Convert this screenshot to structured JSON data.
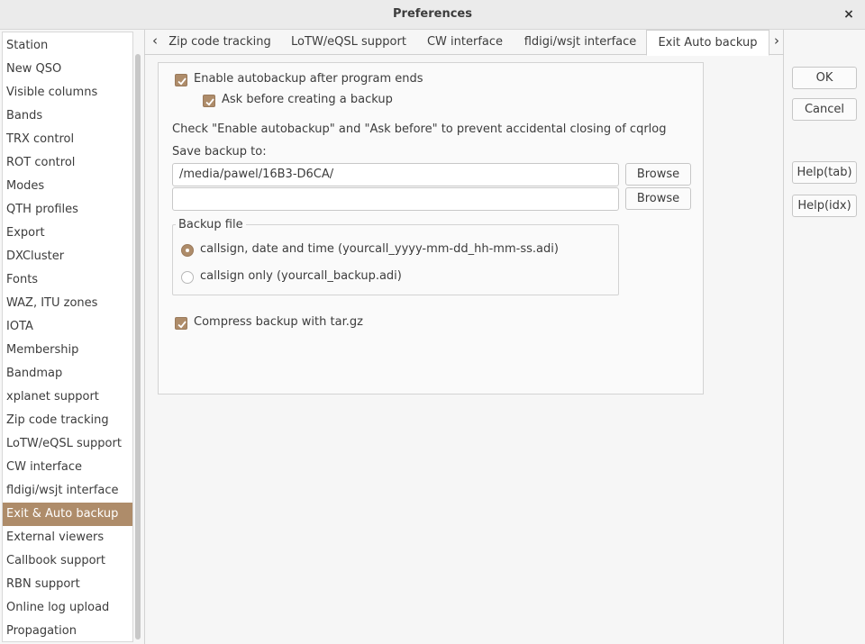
{
  "window": {
    "title": "Preferences",
    "close_glyph": "×"
  },
  "sidebar": {
    "selected_index": 21,
    "items": [
      "Station",
      "New QSO",
      "Visible columns",
      "Bands",
      "TRX control",
      "ROT control",
      "Modes",
      "QTH profiles",
      "Export",
      "DXCluster",
      "Fonts",
      "WAZ, ITU zones",
      "IOTA",
      "Membership",
      "Bandmap",
      "xplanet support",
      "Zip code tracking",
      "LoTW/eQSL support",
      "CW interface",
      "fldigi/wsjt interface",
      "Exit & Auto backup",
      "External viewers",
      "Callbook support",
      "RBN support",
      "Online log upload",
      "Propagation"
    ]
  },
  "tabs": {
    "left_arrow": "‹",
    "right_arrow": "›",
    "items": [
      "Zip code tracking",
      "LoTW/eQSL support",
      "CW interface",
      "fldigi/wsjt interface",
      "Exit  Auto backup"
    ],
    "active_index": 4
  },
  "backup": {
    "enable_autobackup": {
      "label": "Enable autobackup after program ends",
      "checked": true
    },
    "ask_before": {
      "label": "Ask before creating a backup",
      "checked": true
    },
    "hint": "Check \"Enable autobackup\" and \"Ask before\" to prevent accidental closing of cqrlog",
    "save_to_label": "Save backup to:",
    "path1": "/media/pawel/16B3-D6CA/",
    "path2": "",
    "browse_label": "Browse",
    "backup_file": {
      "title": "Backup file",
      "options": [
        {
          "label": "callsign, date and time (yourcall_yyyy-mm-dd_hh-mm-ss.adi)",
          "selected": true
        },
        {
          "label": "callsign only (yourcall_backup.adi)",
          "selected": false
        }
      ]
    },
    "compress": {
      "label": "Compress backup with tar.gz",
      "checked": true
    }
  },
  "buttons": {
    "ok": "OK",
    "cancel": "Cancel",
    "help_tab": "Help(tab)",
    "help_idx": "Help(idx)"
  },
  "colors": {
    "accent": "#ae8c6a",
    "selection_text": "#ffffff"
  }
}
